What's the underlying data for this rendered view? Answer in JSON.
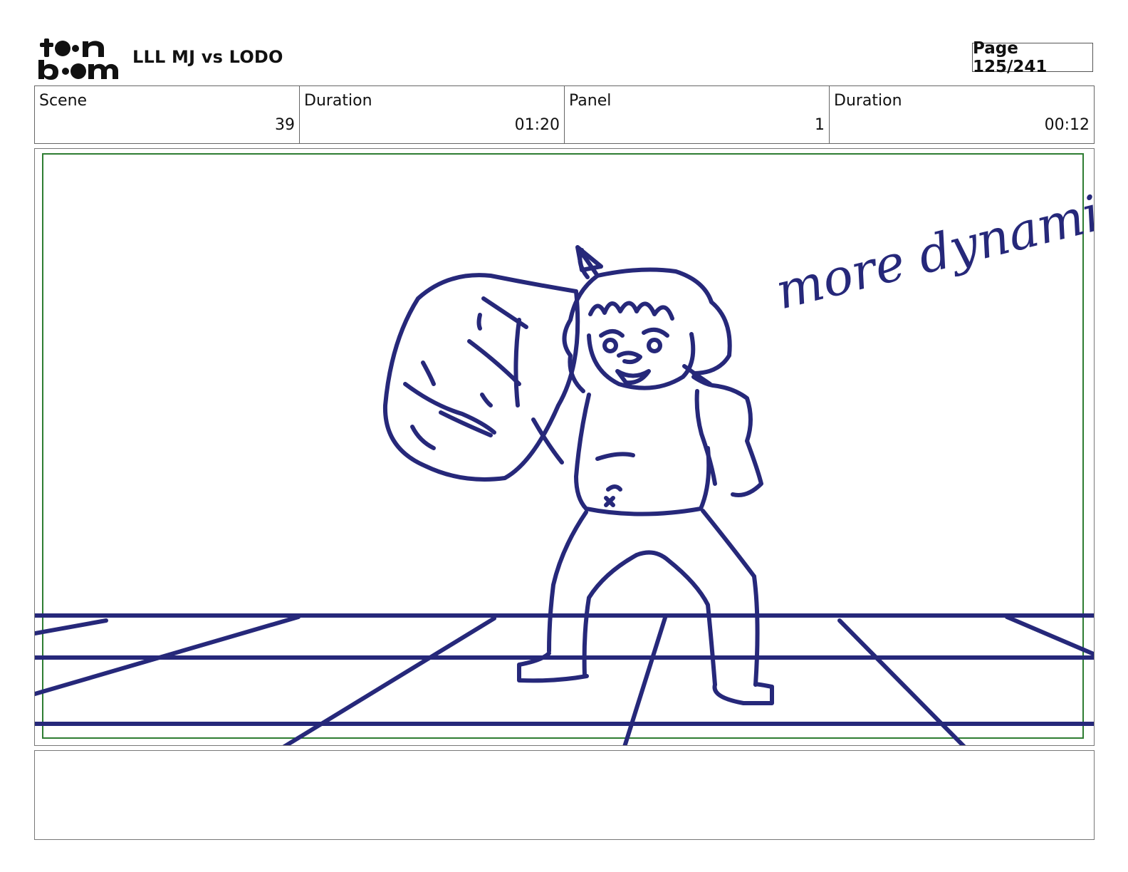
{
  "header": {
    "logo_text": "toon boom",
    "project_title": "LLL MJ vs LODO",
    "page_indicator": "Page 125/241"
  },
  "info_bar": {
    "scene_label": "Scene",
    "scene_value": "39",
    "scene_duration_label": "Duration",
    "scene_duration_value": "01:20",
    "panel_label": "Panel",
    "panel_value": "1",
    "panel_duration_label": "Duration",
    "panel_duration_value": "00:12"
  },
  "panel": {
    "annotation": "more dynamic!",
    "sketch_color": "#26287a",
    "safe_frame_color": "#2e7d32"
  },
  "notes": {
    "text": ""
  }
}
